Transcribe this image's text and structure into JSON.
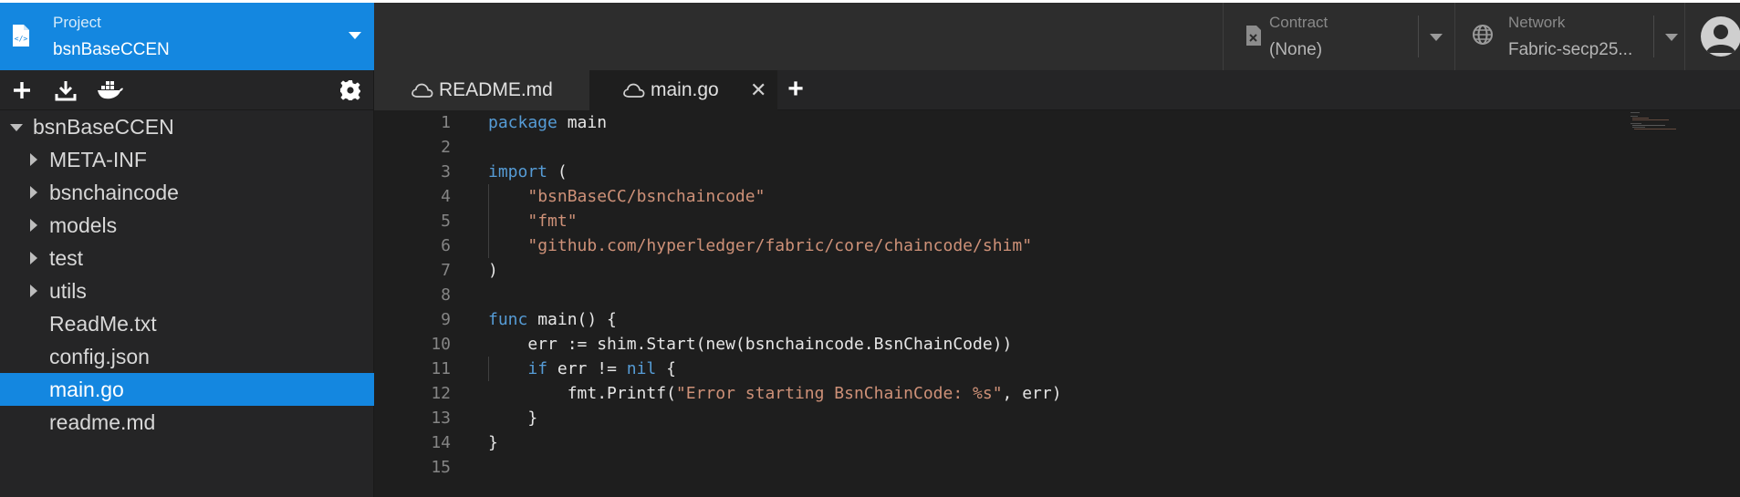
{
  "header": {
    "project": {
      "caption": "Project",
      "value": "bsnBaseCCEN"
    },
    "contract": {
      "caption": "Contract",
      "value": "(None)"
    },
    "network": {
      "caption": "Network",
      "value": "Fabric-secp25..."
    }
  },
  "sidebar": {
    "toolbar_icons": [
      "plus-icon",
      "download-icon",
      "docker-icon",
      "gear-icon"
    ],
    "tree": [
      {
        "label": "bsnBaseCCEN",
        "type": "folder-open",
        "level": 0
      },
      {
        "label": "META-INF",
        "type": "folder",
        "level": 1
      },
      {
        "label": "bsnchaincode",
        "type": "folder",
        "level": 1
      },
      {
        "label": "models",
        "type": "folder",
        "level": 1
      },
      {
        "label": "test",
        "type": "folder",
        "level": 1
      },
      {
        "label": "utils",
        "type": "folder",
        "level": 1
      },
      {
        "label": "ReadMe.txt",
        "type": "file",
        "level": 1
      },
      {
        "label": "config.json",
        "type": "file",
        "level": 1
      },
      {
        "label": "main.go",
        "type": "file",
        "level": 1,
        "selected": true
      },
      {
        "label": "readme.md",
        "type": "file",
        "level": 1
      }
    ]
  },
  "tabs": [
    {
      "label": "README.md",
      "active": false
    },
    {
      "label": "main.go",
      "active": true,
      "close": "✕"
    }
  ],
  "add_tab": "+",
  "editor": {
    "line_numbers": [
      "1",
      "2",
      "3",
      "4",
      "5",
      "6",
      "7",
      "8",
      "9",
      "10",
      "11",
      "12",
      "13",
      "14",
      "15"
    ],
    "lines": [
      [
        {
          "k": "kw",
          "t": "package"
        },
        {
          "t": " main"
        }
      ],
      [],
      [
        {
          "k": "kw",
          "t": "import"
        },
        {
          "t": " ("
        }
      ],
      [
        {
          "t": "    "
        },
        {
          "k": "str",
          "t": "\"bsnBaseCC/bsnchaincode\""
        }
      ],
      [
        {
          "t": "    "
        },
        {
          "k": "str",
          "t": "\"fmt\""
        }
      ],
      [
        {
          "t": "    "
        },
        {
          "k": "str",
          "t": "\"github.com/hyperledger/fabric/core/chaincode/shim\""
        }
      ],
      [
        {
          "t": ")"
        }
      ],
      [],
      [
        {
          "k": "kw",
          "t": "func"
        },
        {
          "t": " main() {"
        }
      ],
      [
        {
          "t": "    err := shim.Start(new(bsnchaincode.BsnChainCode))"
        }
      ],
      [
        {
          "t": "    "
        },
        {
          "k": "kw",
          "t": "if"
        },
        {
          "t": " err != "
        },
        {
          "k": "kw",
          "t": "nil"
        },
        {
          "t": " {"
        }
      ],
      [
        {
          "t": "        fmt.Printf("
        },
        {
          "k": "str",
          "t": "\"Error starting BsnChainCode: %s\""
        },
        {
          "t": ", err)"
        }
      ],
      [
        {
          "t": "    }"
        }
      ],
      [
        {
          "t": "}"
        }
      ],
      []
    ]
  },
  "colors": {
    "accent": "#1487e0",
    "keyword": "#569cd6",
    "string": "#ce9178",
    "background": "#1e1e1e"
  }
}
